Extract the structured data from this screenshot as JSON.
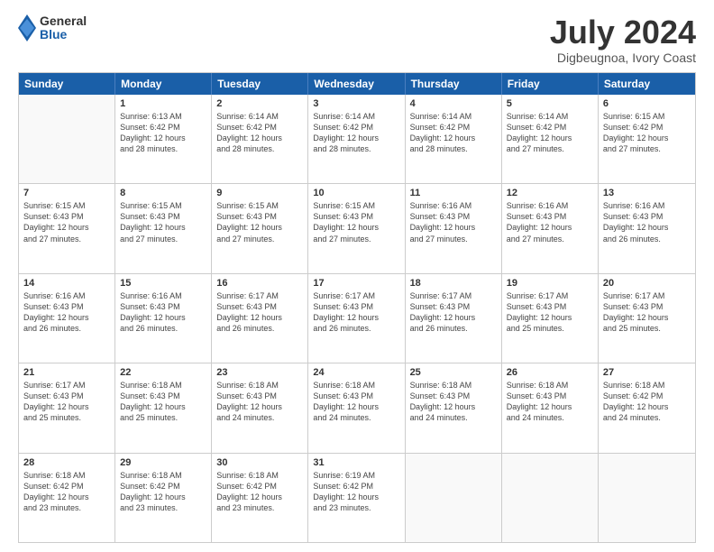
{
  "header": {
    "logo": {
      "line1": "General",
      "line2": "Blue"
    },
    "month": "July 2024",
    "location": "Digbeugnoa, Ivory Coast"
  },
  "weekdays": [
    "Sunday",
    "Monday",
    "Tuesday",
    "Wednesday",
    "Thursday",
    "Friday",
    "Saturday"
  ],
  "rows": [
    [
      {
        "day": "",
        "info": ""
      },
      {
        "day": "1",
        "info": "Sunrise: 6:13 AM\nSunset: 6:42 PM\nDaylight: 12 hours\nand 28 minutes."
      },
      {
        "day": "2",
        "info": "Sunrise: 6:14 AM\nSunset: 6:42 PM\nDaylight: 12 hours\nand 28 minutes."
      },
      {
        "day": "3",
        "info": "Sunrise: 6:14 AM\nSunset: 6:42 PM\nDaylight: 12 hours\nand 28 minutes."
      },
      {
        "day": "4",
        "info": "Sunrise: 6:14 AM\nSunset: 6:42 PM\nDaylight: 12 hours\nand 28 minutes."
      },
      {
        "day": "5",
        "info": "Sunrise: 6:14 AM\nSunset: 6:42 PM\nDaylight: 12 hours\nand 27 minutes."
      },
      {
        "day": "6",
        "info": "Sunrise: 6:15 AM\nSunset: 6:42 PM\nDaylight: 12 hours\nand 27 minutes."
      }
    ],
    [
      {
        "day": "7",
        "info": "Sunrise: 6:15 AM\nSunset: 6:43 PM\nDaylight: 12 hours\nand 27 minutes."
      },
      {
        "day": "8",
        "info": "Sunrise: 6:15 AM\nSunset: 6:43 PM\nDaylight: 12 hours\nand 27 minutes."
      },
      {
        "day": "9",
        "info": "Sunrise: 6:15 AM\nSunset: 6:43 PM\nDaylight: 12 hours\nand 27 minutes."
      },
      {
        "day": "10",
        "info": "Sunrise: 6:15 AM\nSunset: 6:43 PM\nDaylight: 12 hours\nand 27 minutes."
      },
      {
        "day": "11",
        "info": "Sunrise: 6:16 AM\nSunset: 6:43 PM\nDaylight: 12 hours\nand 27 minutes."
      },
      {
        "day": "12",
        "info": "Sunrise: 6:16 AM\nSunset: 6:43 PM\nDaylight: 12 hours\nand 27 minutes."
      },
      {
        "day": "13",
        "info": "Sunrise: 6:16 AM\nSunset: 6:43 PM\nDaylight: 12 hours\nand 26 minutes."
      }
    ],
    [
      {
        "day": "14",
        "info": "Sunrise: 6:16 AM\nSunset: 6:43 PM\nDaylight: 12 hours\nand 26 minutes."
      },
      {
        "day": "15",
        "info": "Sunrise: 6:16 AM\nSunset: 6:43 PM\nDaylight: 12 hours\nand 26 minutes."
      },
      {
        "day": "16",
        "info": "Sunrise: 6:17 AM\nSunset: 6:43 PM\nDaylight: 12 hours\nand 26 minutes."
      },
      {
        "day": "17",
        "info": "Sunrise: 6:17 AM\nSunset: 6:43 PM\nDaylight: 12 hours\nand 26 minutes."
      },
      {
        "day": "18",
        "info": "Sunrise: 6:17 AM\nSunset: 6:43 PM\nDaylight: 12 hours\nand 26 minutes."
      },
      {
        "day": "19",
        "info": "Sunrise: 6:17 AM\nSunset: 6:43 PM\nDaylight: 12 hours\nand 25 minutes."
      },
      {
        "day": "20",
        "info": "Sunrise: 6:17 AM\nSunset: 6:43 PM\nDaylight: 12 hours\nand 25 minutes."
      }
    ],
    [
      {
        "day": "21",
        "info": "Sunrise: 6:17 AM\nSunset: 6:43 PM\nDaylight: 12 hours\nand 25 minutes."
      },
      {
        "day": "22",
        "info": "Sunrise: 6:18 AM\nSunset: 6:43 PM\nDaylight: 12 hours\nand 25 minutes."
      },
      {
        "day": "23",
        "info": "Sunrise: 6:18 AM\nSunset: 6:43 PM\nDaylight: 12 hours\nand 24 minutes."
      },
      {
        "day": "24",
        "info": "Sunrise: 6:18 AM\nSunset: 6:43 PM\nDaylight: 12 hours\nand 24 minutes."
      },
      {
        "day": "25",
        "info": "Sunrise: 6:18 AM\nSunset: 6:43 PM\nDaylight: 12 hours\nand 24 minutes."
      },
      {
        "day": "26",
        "info": "Sunrise: 6:18 AM\nSunset: 6:43 PM\nDaylight: 12 hours\nand 24 minutes."
      },
      {
        "day": "27",
        "info": "Sunrise: 6:18 AM\nSunset: 6:42 PM\nDaylight: 12 hours\nand 24 minutes."
      }
    ],
    [
      {
        "day": "28",
        "info": "Sunrise: 6:18 AM\nSunset: 6:42 PM\nDaylight: 12 hours\nand 23 minutes."
      },
      {
        "day": "29",
        "info": "Sunrise: 6:18 AM\nSunset: 6:42 PM\nDaylight: 12 hours\nand 23 minutes."
      },
      {
        "day": "30",
        "info": "Sunrise: 6:18 AM\nSunset: 6:42 PM\nDaylight: 12 hours\nand 23 minutes."
      },
      {
        "day": "31",
        "info": "Sunrise: 6:19 AM\nSunset: 6:42 PM\nDaylight: 12 hours\nand 23 minutes."
      },
      {
        "day": "",
        "info": ""
      },
      {
        "day": "",
        "info": ""
      },
      {
        "day": "",
        "info": ""
      }
    ]
  ]
}
